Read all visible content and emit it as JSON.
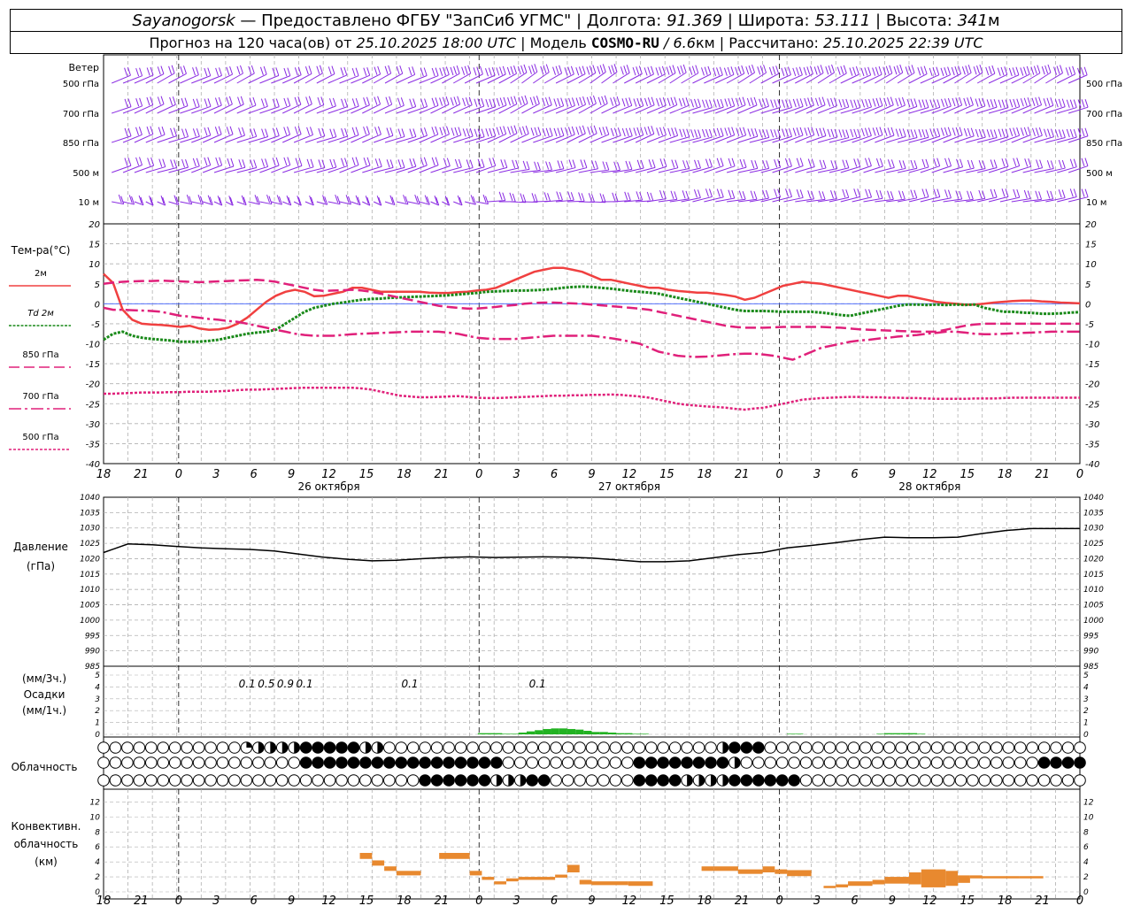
{
  "header": {
    "station": "Sayanogorsk",
    "dash": " — ",
    "provider": "Предоставлено ФГБУ \"ЗапСиб УГМС\"",
    "lon_label": "Долгота:",
    "lon_value": "91.369",
    "lat_label": "Широта:",
    "lat_value": "53.111",
    "alt_label": "Высота:",
    "alt_value": "341",
    "alt_unit": "м",
    "sep": " | ",
    "forecast_prefix": "Прогноз на 120 часа(ов) от ",
    "forecast_time": "25.10.2025 18:00 UTC",
    "model_label": "Модель ",
    "model_name": "COSMO-RU",
    "model_slash": " / ",
    "model_res": "6.6",
    "model_res_unit": "км",
    "calc_label": "Рассчитано: ",
    "calc_time": "25.10.2025 22:39 UTC"
  },
  "colors": {
    "wind": "#8a2be2",
    "t2m": "#f04040",
    "td2m": "#1a8a1a",
    "magenta": "#e0207a",
    "pressure": "#000000",
    "precip": "#22b222",
    "conv": "#e8892f",
    "grid": "#b0b0b0",
    "zero": "#4060ff"
  },
  "wind_panel": {
    "title": "Ветер",
    "levels": [
      "500 гПа",
      "700 гПа",
      "850 гПа",
      "500 м",
      "10 м"
    ]
  },
  "x_axis": {
    "hour_labels": [
      "18",
      "21",
      "0",
      "3",
      "6",
      "9",
      "12",
      "15",
      "18",
      "21",
      "0",
      "3",
      "6",
      "9",
      "12",
      "15",
      "18",
      "21",
      "0",
      "3",
      "6",
      "9",
      "12",
      "15",
      "18",
      "21",
      "0"
    ],
    "dates": [
      "26 октября",
      "27 октября",
      "28 октября"
    ]
  },
  "chart_data": [
    {
      "type": "line",
      "title": "Тем-ра(°C)",
      "x_hours": [
        0,
        3,
        6,
        9,
        12,
        15,
        18,
        21,
        24,
        27,
        30,
        33,
        36,
        39,
        42,
        45,
        48,
        51,
        54,
        57,
        60,
        63,
        66,
        69,
        72,
        75,
        78,
        81,
        84,
        87,
        90,
        93,
        96,
        99,
        102,
        105,
        108,
        111,
        114,
        117,
        120,
        123,
        126,
        129,
        132,
        135,
        138,
        141,
        144,
        147,
        150,
        153,
        156,
        159,
        162,
        165,
        168,
        171,
        174,
        177,
        180,
        183,
        186,
        189,
        192,
        195,
        198,
        201,
        204,
        207,
        210,
        213,
        216,
        219,
        222,
        225,
        228,
        231,
        234,
        237,
        240,
        243,
        246,
        249,
        252,
        255,
        258,
        261,
        264,
        267,
        270,
        273,
        276,
        279,
        282,
        285,
        288,
        291,
        294,
        297,
        300,
        303,
        306
      ],
      "ylim": [
        -40,
        20
      ],
      "yticks": [
        20,
        15,
        10,
        5,
        0,
        -5,
        -10,
        -15,
        -20,
        -25,
        -30,
        -35,
        -40
      ],
      "series": [
        {
          "name": "2м",
          "style": "solid",
          "values": [
            7.5,
            5.2,
            -1.5,
            -4,
            -5,
            -5.2,
            -5.3,
            -5.5,
            -5.8,
            -5.5,
            -6.2,
            -6.5,
            -6.4,
            -6,
            -5,
            -3.5,
            -1.5,
            0.5,
            2,
            3,
            3.5,
            3,
            1.9,
            2,
            2.5,
            3,
            4,
            4,
            3.5,
            3,
            3,
            3,
            3,
            3,
            2.8,
            2.7,
            2.7,
            2.9,
            3,
            3.3,
            3.5,
            4,
            5,
            6,
            7,
            8,
            8.5,
            9,
            9,
            8.5,
            8,
            7,
            6,
            6,
            5.5,
            5,
            4.5,
            4,
            4,
            3.5,
            3.2,
            3,
            2.8,
            2.8,
            2.5,
            2.2,
            1.8,
            1,
            1.5,
            2.5,
            3.5,
            4.5,
            5,
            5.5,
            5.2,
            5,
            4.5,
            4,
            3.5,
            3,
            2.5,
            2,
            1.5,
            2,
            2,
            1.5,
            1,
            0.5,
            0.2,
            0,
            -0.2,
            -0.2,
            0,
            0.3,
            0.5,
            0.7,
            0.8,
            0.8,
            0.6,
            0.5,
            0.3,
            0.2,
            0.1
          ]
        },
        {
          "name": "Td 2м",
          "style": "dotted",
          "values": [
            -9,
            -7.5,
            -7,
            -8,
            -8.5,
            -8.8,
            -9,
            -9.2,
            -9.5,
            -9.5,
            -9.5,
            -9.3,
            -9,
            -8.5,
            -8,
            -7.5,
            -7.2,
            -7,
            -6.5,
            -5,
            -3.5,
            -2,
            -1,
            -0.5,
            0,
            0.3,
            0.7,
            1,
            1.2,
            1.3,
            1.5,
            1.6,
            1.7,
            1.8,
            1.9,
            2,
            2.1,
            2.3,
            2.5,
            2.7,
            3,
            3.1,
            3.2,
            3.3,
            3.3,
            3.4,
            3.5,
            3.7,
            4,
            4.2,
            4.3,
            4.2,
            4,
            3.8,
            3.5,
            3.2,
            3,
            2.8,
            2.5,
            2,
            1.5,
            1,
            0.5,
            0,
            -0.5,
            -1,
            -1.5,
            -1.8,
            -1.8,
            -1.8,
            -1.9,
            -2,
            -2,
            -2,
            -2,
            -2.2,
            -2.5,
            -2.8,
            -3,
            -2.5,
            -2,
            -1.5,
            -1,
            -0.5,
            -0.2,
            -0.2,
            -0.3,
            -0.2,
            -0.3,
            -0.2,
            -0.3,
            -0.2,
            -1,
            -1.5,
            -2,
            -2,
            -2.2,
            -2.3,
            -2.5,
            -2.5,
            -2.4,
            -2.2,
            -2.1,
            -2
          ]
        },
        {
          "name": "850 гПа",
          "style": "dash",
          "values": [
            5,
            5.3,
            5.5,
            5.6,
            5.7,
            5.7,
            5.8,
            5.7,
            5.6,
            5.5,
            5.4,
            5.5,
            5.6,
            5.7,
            5.8,
            5.9,
            6,
            5.8,
            5.5,
            5,
            4.5,
            4,
            3.5,
            3.2,
            3.3,
            3.4,
            3.5,
            3.3,
            3,
            2.5,
            2,
            1.5,
            1,
            0.5,
            0,
            -0.5,
            -0.8,
            -1,
            -1.2,
            -1.2,
            -1,
            -0.8,
            -0.5,
            -0.3,
            0,
            0.2,
            0.3,
            0.3,
            0.2,
            0.1,
            0,
            -0.2,
            -0.4,
            -0.6,
            -0.8,
            -1,
            -1.2,
            -1.5,
            -2,
            -2.5,
            -3,
            -3.5,
            -4,
            -4.5,
            -5,
            -5.5,
            -5.8,
            -6,
            -6,
            -6,
            -5.9,
            -5.8,
            -5.8,
            -5.8,
            -5.8,
            -5.8,
            -5.9,
            -6,
            -6.2,
            -6.4,
            -6.5,
            -6.6,
            -6.7,
            -6.8,
            -6.9,
            -7,
            -7,
            -7,
            -6.5,
            -6,
            -5.5,
            -5.2,
            -5,
            -5,
            -5,
            -5,
            -5,
            -5,
            -5,
            -5,
            -5,
            -5,
            -5
          ]
        },
        {
          "name": "700 гПа",
          "style": "dashdot",
          "values": [
            -1,
            -1.5,
            -1.5,
            -1.6,
            -1.7,
            -1.8,
            -2,
            -2.5,
            -3,
            -3.2,
            -3.5,
            -3.8,
            -4,
            -4.3,
            -4.5,
            -5,
            -5.5,
            -6,
            -6.5,
            -7,
            -7.5,
            -7.8,
            -8,
            -8,
            -8,
            -7.8,
            -7.6,
            -7.5,
            -7.4,
            -7.3,
            -7.2,
            -7.1,
            -7,
            -7,
            -7,
            -7,
            -7.2,
            -7.5,
            -8,
            -8.5,
            -8.7,
            -8.8,
            -8.8,
            -8.8,
            -8.6,
            -8.4,
            -8.2,
            -8,
            -8,
            -8,
            -8,
            -8,
            -8.3,
            -8.6,
            -9,
            -9.5,
            -10,
            -11,
            -12,
            -12.5,
            -13,
            -13.2,
            -13.3,
            -13.2,
            -13,
            -12.8,
            -12.6,
            -12.5,
            -12.5,
            -12.7,
            -13,
            -13.5,
            -14,
            -13,
            -12,
            -11,
            -10.5,
            -10,
            -9.5,
            -9.2,
            -9,
            -8.7,
            -8.5,
            -8.2,
            -8,
            -7.8,
            -7.5,
            -7.3,
            -7,
            -7,
            -7.2,
            -7.5,
            -7.6,
            -7.6,
            -7.5,
            -7.4,
            -7.3,
            -7.2,
            -7.1,
            -7,
            -7,
            -7,
            -7
          ]
        },
        {
          "name": "500 гПа",
          "style": "densedot",
          "values": [
            -22.5,
            -22.5,
            -22.4,
            -22.3,
            -22.2,
            -22.2,
            -22.2,
            -22.1,
            -22.1,
            -22,
            -22,
            -22,
            -21.9,
            -21.8,
            -21.6,
            -21.5,
            -21.5,
            -21.4,
            -21.3,
            -21.2,
            -21.1,
            -21,
            -21,
            -21,
            -21,
            -21,
            -21,
            -21.2,
            -21.5,
            -22,
            -22.5,
            -23,
            -23.2,
            -23.4,
            -23.4,
            -23.3,
            -23.2,
            -23.1,
            -23.3,
            -23.5,
            -23.6,
            -23.6,
            -23.5,
            -23.4,
            -23.3,
            -23.2,
            -23.1,
            -23,
            -23,
            -22.9,
            -22.9,
            -22.8,
            -22.8,
            -22.7,
            -22.8,
            -23,
            -23.2,
            -23.5,
            -24,
            -24.5,
            -25,
            -25.3,
            -25.5,
            -25.7,
            -25.8,
            -26,
            -26.3,
            -26.5,
            -26.2,
            -26,
            -25.5,
            -25,
            -24.5,
            -24,
            -23.8,
            -23.6,
            -23.5,
            -23.4,
            -23.3,
            -23.3,
            -23.4,
            -23.4,
            -23.5,
            -23.5,
            -23.6,
            -23.6,
            -23.7,
            -23.8,
            -23.8,
            -23.8,
            -23.8,
            -23.7,
            -23.7,
            -23.7,
            -23.6,
            -23.5,
            -23.5,
            -23.5,
            -23.5,
            -23.5,
            -23.5,
            -23.5,
            -23.5
          ]
        }
      ]
    },
    {
      "type": "line",
      "title": "Давление",
      "ylabel": "(гПа)",
      "ylim": [
        985,
        1040
      ],
      "yticks": [
        1040,
        1035,
        1030,
        1025,
        1020,
        1015,
        1010,
        1005,
        1000,
        995,
        990,
        985
      ],
      "x_hours": [
        0,
        3,
        6,
        9,
        12,
        15,
        18,
        21,
        24,
        27,
        30,
        33,
        36,
        39,
        42,
        45,
        48,
        51,
        54,
        57,
        60,
        63,
        66,
        69,
        72,
        75,
        78,
        81,
        84,
        87,
        90,
        93,
        96,
        99,
        102,
        105,
        108,
        111,
        114,
        117,
        120
      ],
      "values": [
        1022,
        1024.8,
        1024.5,
        1024,
        1023.5,
        1023.2,
        1023,
        1022.5,
        1021.5,
        1020.5,
        1019.8,
        1019.3,
        1019.5,
        1020,
        1020.4,
        1020.6,
        1020.4,
        1020.5,
        1020.6,
        1020.5,
        1020.2,
        1019.6,
        1019,
        1019,
        1019.3,
        1020.3,
        1021.3,
        1022,
        1023.5,
        1024.3,
        1025.2,
        1026.2,
        1027,
        1026.8,
        1026.8,
        1027,
        1028.2,
        1029.2,
        1029.8,
        1029.8,
        1029.8
      ]
    },
    {
      "type": "bar",
      "title": "Осадки",
      "ylabel_3h": "(мм/3ч.)",
      "ylabel_1h": "(мм/1ч.)",
      "ylim": [
        0,
        5
      ],
      "yticks": [
        5,
        4,
        3,
        2,
        1,
        0
      ],
      "labels_hours": [
        45,
        51,
        57,
        63,
        96,
        136
      ],
      "labels": [
        "0.1",
        "0.5",
        "0.9",
        "0.1",
        "0.1",
        "0.1"
      ],
      "hourly_x": [
        46,
        47,
        48,
        49,
        50,
        51,
        52,
        53,
        54,
        55,
        56,
        57,
        58,
        59,
        60,
        61,
        62,
        63,
        64,
        65,
        66,
        84,
        85,
        95,
        96,
        97,
        98,
        99,
        100
      ],
      "hourly_values": [
        0.1,
        0.1,
        0.1,
        0.05,
        0.05,
        0.15,
        0.25,
        0.35,
        0.45,
        0.5,
        0.5,
        0.45,
        0.4,
        0.3,
        0.2,
        0.2,
        0.15,
        0.1,
        0.1,
        0.05,
        0.05,
        0.05,
        0.05,
        0.05,
        0.1,
        0.1,
        0.1,
        0.1,
        0.05
      ]
    },
    {
      "type": "table",
      "title": "Облачность",
      "note": "cloud cover fraction in eighths per hour step, rows: upper, middle, lower",
      "hours": [
        0,
        120
      ],
      "rows": [
        "0000000000000000000000003848484848888888888848400000000000000000000000000000000000000000000000000000000048888880000000000000000000000000000000000000000000000000000000004848484848",
        "0000000000000000000000000000000008888888888888888888888888888884848400000000000000000000008888888888888888400000000000000000000000000000000000000000000000000088888888888",
        "0000000000000000000000000000000000000000000000000000048888888888884848408480000000000000088884848448484848888888888880000000000000000000000000000000000000000"
      ]
    },
    {
      "type": "bar",
      "title": "Конвективн. облачность (км)",
      "ylim": [
        0,
        13
      ],
      "yticks": [
        12,
        10,
        8,
        6,
        4,
        2,
        0
      ],
      "segments": [
        {
          "x0": 42,
          "x1": 44,
          "bottom": 4.4,
          "top": 5.2
        },
        {
          "x0": 44,
          "x1": 46,
          "bottom": 3.5,
          "top": 4.2
        },
        {
          "x0": 46,
          "x1": 48,
          "bottom": 2.8,
          "top": 3.4
        },
        {
          "x0": 48,
          "x1": 52,
          "bottom": 2.2,
          "top": 2.8
        },
        {
          "x0": 55,
          "x1": 60,
          "bottom": 4.4,
          "top": 5.2
        },
        {
          "x0": 60,
          "x1": 62,
          "bottom": 2.2,
          "top": 2.8
        },
        {
          "x0": 62,
          "x1": 64,
          "bottom": 1.6,
          "top": 2
        },
        {
          "x0": 64,
          "x1": 66,
          "bottom": 1,
          "top": 1.4
        },
        {
          "x0": 66,
          "x1": 68,
          "bottom": 1.4,
          "top": 1.8
        },
        {
          "x0": 68,
          "x1": 74,
          "bottom": 1.6,
          "top": 2
        },
        {
          "x0": 74,
          "x1": 76,
          "bottom": 1.9,
          "top": 2.3
        },
        {
          "x0": 76,
          "x1": 78,
          "bottom": 2.6,
          "top": 3.6
        },
        {
          "x0": 78,
          "x1": 80,
          "bottom": 1,
          "top": 1.6
        },
        {
          "x0": 80,
          "x1": 86,
          "bottom": 0.9,
          "top": 1.4
        },
        {
          "x0": 86,
          "x1": 90,
          "bottom": 0.8,
          "top": 1.4
        },
        {
          "x0": 98,
          "x1": 100,
          "bottom": 2.8,
          "top": 3.4
        },
        {
          "x0": 100,
          "x1": 104,
          "bottom": 2.8,
          "top": 3.4
        },
        {
          "x0": 104,
          "x1": 108,
          "bottom": 2.4,
          "top": 3
        },
        {
          "x0": 108,
          "x1": 110,
          "bottom": 2.6,
          "top": 3.4
        },
        {
          "x0": 110,
          "x1": 112,
          "bottom": 2.4,
          "top": 3
        },
        {
          "x0": 112,
          "x1": 116,
          "bottom": 2.1,
          "top": 2.9
        },
        {
          "x0": 118,
          "x1": 120,
          "bottom": 0.5,
          "top": 0.8
        },
        {
          "x0": 120,
          "x1": 122,
          "bottom": 0.6,
          "top": 1
        },
        {
          "x0": 122,
          "x1": 126,
          "bottom": 0.8,
          "top": 1.4
        },
        {
          "x0": 126,
          "x1": 128,
          "bottom": 1,
          "top": 1.6
        },
        {
          "x0": 128,
          "x1": 132,
          "bottom": 1.1,
          "top": 2
        },
        {
          "x0": 132,
          "x1": 134,
          "bottom": 1,
          "top": 2.6
        },
        {
          "x0": 134,
          "x1": 138,
          "bottom": 0.6,
          "top": 3
        },
        {
          "x0": 138,
          "x1": 140,
          "bottom": 0.8,
          "top": 2.8
        },
        {
          "x0": 140,
          "x1": 142,
          "bottom": 1.2,
          "top": 2.2
        },
        {
          "x0": 142,
          "x1": 144,
          "bottom": 1.8,
          "top": 2.2
        },
        {
          "x0": 144,
          "x1": 150,
          "bottom": 1.8,
          "top": 2.1
        },
        {
          "x0": 150,
          "x1": 154,
          "bottom": 1.8,
          "top": 2.1
        }
      ]
    }
  ]
}
